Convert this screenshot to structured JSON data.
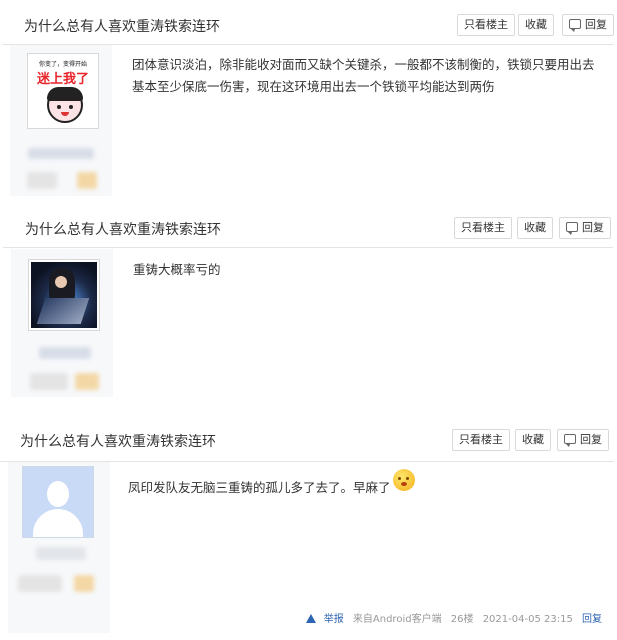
{
  "thread": {
    "title": "为什么总有人喜欢重涛铁索连环"
  },
  "header_buttons": {
    "only_op": "只看楼主",
    "favorite": "收藏",
    "reply": "回复"
  },
  "posts": [
    {
      "avatar_caption_top": "你变了，变得开始",
      "avatar_caption_main": "迷上我了",
      "text": "团体意识淡泊，除非能收对面而又缺个关键杀，一般都不该制衡的，铁锁只要用出去基本至少保底一伤害，现在这环境用出去一个铁锁平均能达到两伤"
    },
    {
      "text": "重铸大概率亏的"
    },
    {
      "text": "凤印发队友无脑三重铸的孤儿多了去了。早麻了",
      "footer": {
        "report": "举报",
        "source": "来自Android客户端",
        "floor": "26楼",
        "time": "2021-04-05 23:15",
        "reply": "回复"
      }
    }
  ]
}
